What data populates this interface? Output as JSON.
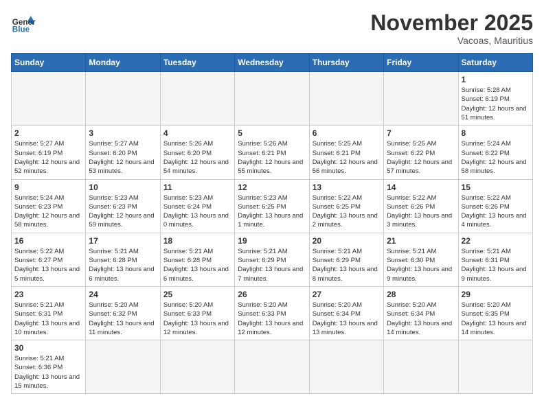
{
  "logo": {
    "text_general": "General",
    "text_blue": "Blue"
  },
  "title": "November 2025",
  "location": "Vacoas, Mauritius",
  "days_of_week": [
    "Sunday",
    "Monday",
    "Tuesday",
    "Wednesday",
    "Thursday",
    "Friday",
    "Saturday"
  ],
  "weeks": [
    [
      {
        "day": "",
        "info": ""
      },
      {
        "day": "",
        "info": ""
      },
      {
        "day": "",
        "info": ""
      },
      {
        "day": "",
        "info": ""
      },
      {
        "day": "",
        "info": ""
      },
      {
        "day": "",
        "info": ""
      },
      {
        "day": "1",
        "info": "Sunrise: 5:28 AM\nSunset: 6:19 PM\nDaylight: 12 hours and 51 minutes."
      }
    ],
    [
      {
        "day": "2",
        "info": "Sunrise: 5:27 AM\nSunset: 6:19 PM\nDaylight: 12 hours and 52 minutes."
      },
      {
        "day": "3",
        "info": "Sunrise: 5:27 AM\nSunset: 6:20 PM\nDaylight: 12 hours and 53 minutes."
      },
      {
        "day": "4",
        "info": "Sunrise: 5:26 AM\nSunset: 6:20 PM\nDaylight: 12 hours and 54 minutes."
      },
      {
        "day": "5",
        "info": "Sunrise: 5:26 AM\nSunset: 6:21 PM\nDaylight: 12 hours and 55 minutes."
      },
      {
        "day": "6",
        "info": "Sunrise: 5:25 AM\nSunset: 6:21 PM\nDaylight: 12 hours and 56 minutes."
      },
      {
        "day": "7",
        "info": "Sunrise: 5:25 AM\nSunset: 6:22 PM\nDaylight: 12 hours and 57 minutes."
      },
      {
        "day": "8",
        "info": "Sunrise: 5:24 AM\nSunset: 6:22 PM\nDaylight: 12 hours and 58 minutes."
      }
    ],
    [
      {
        "day": "9",
        "info": "Sunrise: 5:24 AM\nSunset: 6:23 PM\nDaylight: 12 hours and 58 minutes."
      },
      {
        "day": "10",
        "info": "Sunrise: 5:23 AM\nSunset: 6:23 PM\nDaylight: 12 hours and 59 minutes."
      },
      {
        "day": "11",
        "info": "Sunrise: 5:23 AM\nSunset: 6:24 PM\nDaylight: 13 hours and 0 minutes."
      },
      {
        "day": "12",
        "info": "Sunrise: 5:23 AM\nSunset: 6:25 PM\nDaylight: 13 hours and 1 minute."
      },
      {
        "day": "13",
        "info": "Sunrise: 5:22 AM\nSunset: 6:25 PM\nDaylight: 13 hours and 2 minutes."
      },
      {
        "day": "14",
        "info": "Sunrise: 5:22 AM\nSunset: 6:26 PM\nDaylight: 13 hours and 3 minutes."
      },
      {
        "day": "15",
        "info": "Sunrise: 5:22 AM\nSunset: 6:26 PM\nDaylight: 13 hours and 4 minutes."
      }
    ],
    [
      {
        "day": "16",
        "info": "Sunrise: 5:22 AM\nSunset: 6:27 PM\nDaylight: 13 hours and 5 minutes."
      },
      {
        "day": "17",
        "info": "Sunrise: 5:21 AM\nSunset: 6:28 PM\nDaylight: 13 hours and 6 minutes."
      },
      {
        "day": "18",
        "info": "Sunrise: 5:21 AM\nSunset: 6:28 PM\nDaylight: 13 hours and 6 minutes."
      },
      {
        "day": "19",
        "info": "Sunrise: 5:21 AM\nSunset: 6:29 PM\nDaylight: 13 hours and 7 minutes."
      },
      {
        "day": "20",
        "info": "Sunrise: 5:21 AM\nSunset: 6:29 PM\nDaylight: 13 hours and 8 minutes."
      },
      {
        "day": "21",
        "info": "Sunrise: 5:21 AM\nSunset: 6:30 PM\nDaylight: 13 hours and 9 minutes."
      },
      {
        "day": "22",
        "info": "Sunrise: 5:21 AM\nSunset: 6:31 PM\nDaylight: 13 hours and 9 minutes."
      }
    ],
    [
      {
        "day": "23",
        "info": "Sunrise: 5:21 AM\nSunset: 6:31 PM\nDaylight: 13 hours and 10 minutes."
      },
      {
        "day": "24",
        "info": "Sunrise: 5:20 AM\nSunset: 6:32 PM\nDaylight: 13 hours and 11 minutes."
      },
      {
        "day": "25",
        "info": "Sunrise: 5:20 AM\nSunset: 6:33 PM\nDaylight: 13 hours and 12 minutes."
      },
      {
        "day": "26",
        "info": "Sunrise: 5:20 AM\nSunset: 6:33 PM\nDaylight: 13 hours and 12 minutes."
      },
      {
        "day": "27",
        "info": "Sunrise: 5:20 AM\nSunset: 6:34 PM\nDaylight: 13 hours and 13 minutes."
      },
      {
        "day": "28",
        "info": "Sunrise: 5:20 AM\nSunset: 6:34 PM\nDaylight: 13 hours and 14 minutes."
      },
      {
        "day": "29",
        "info": "Sunrise: 5:20 AM\nSunset: 6:35 PM\nDaylight: 13 hours and 14 minutes."
      }
    ],
    [
      {
        "day": "30",
        "info": "Sunrise: 5:21 AM\nSunset: 6:36 PM\nDaylight: 13 hours and 15 minutes."
      },
      {
        "day": "",
        "info": ""
      },
      {
        "day": "",
        "info": ""
      },
      {
        "day": "",
        "info": ""
      },
      {
        "day": "",
        "info": ""
      },
      {
        "day": "",
        "info": ""
      },
      {
        "day": "",
        "info": ""
      }
    ]
  ]
}
